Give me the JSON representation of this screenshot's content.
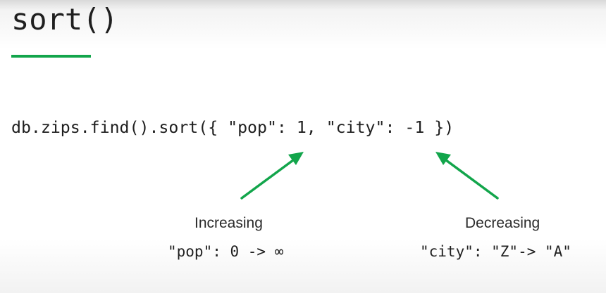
{
  "slide": {
    "title": "sort()",
    "code": "db.zips.find().sort({ \"pop\": 1, \"city\": -1 })",
    "annotations": [
      {
        "label": "Increasing",
        "example": "\"pop\": 0 -> ∞"
      },
      {
        "label": "Decreasing",
        "example": "\"city\": \"Z\"-> \"A\""
      }
    ]
  },
  "colors": {
    "accent": "#12a54b",
    "text": "#1f1f1f",
    "background": "#ffffff"
  }
}
